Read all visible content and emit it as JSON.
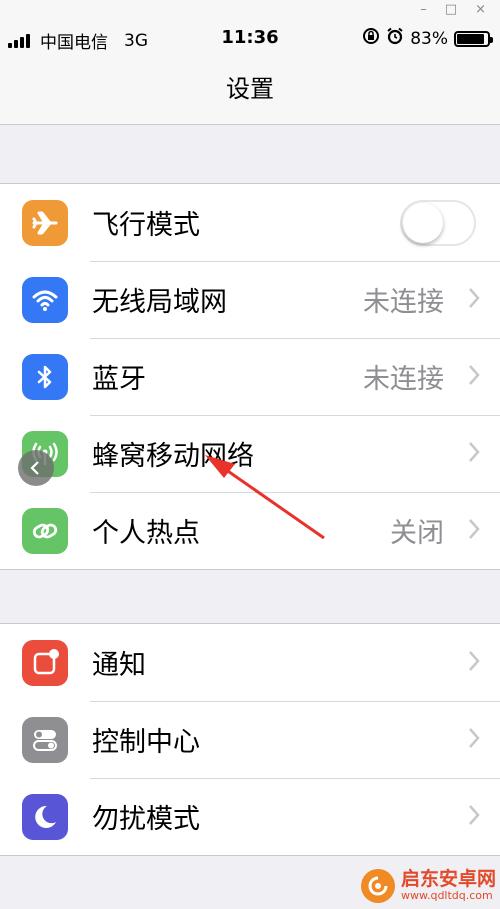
{
  "window_controls": {
    "minimize": "–",
    "maximize": "□",
    "close": "×"
  },
  "statusbar": {
    "carrier": "中国电信",
    "network": "3G",
    "time": "11:36",
    "battery": "83%",
    "battery_level": 0.83
  },
  "navbar": {
    "title": "设置"
  },
  "group1": [
    {
      "icon": "airplane-icon",
      "color": "#f09a37",
      "label": "飞行模式",
      "toggle": "off"
    },
    {
      "icon": "wifi-icon",
      "color": "#3478f6",
      "label": "无线局域网",
      "value": "未连接"
    },
    {
      "icon": "bluetooth-icon",
      "color": "#3478f6",
      "label": "蓝牙",
      "value": "未连接"
    },
    {
      "icon": "cellular-icon",
      "color": "#65c466",
      "label": "蜂窝移动网络"
    },
    {
      "icon": "hotspot-icon",
      "color": "#65c466",
      "label": "个人热点",
      "value": "关闭"
    }
  ],
  "group2": [
    {
      "icon": "notifications-icon",
      "color": "#eb4d3d",
      "label": "通知"
    },
    {
      "icon": "control-center-icon",
      "color": "#8e8e93",
      "label": "控制中心"
    },
    {
      "icon": "do-not-disturb-icon",
      "color": "#5856d6",
      "label": "勿扰模式"
    }
  ],
  "watermark": {
    "name": "启东安卓网",
    "url": "www.qdltdq.com"
  },
  "colors": {
    "arrow": "#e8322a",
    "chevron": "#c7c7cc"
  }
}
